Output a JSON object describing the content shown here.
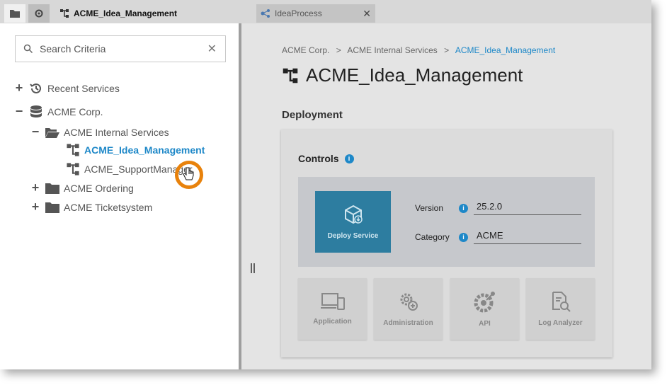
{
  "tabs": {
    "folder_icon": "folder-icon",
    "gear_icon": "gear-icon",
    "active_label": "ACME_Idea_Management",
    "second_label": "IdeaProcess",
    "close_glyph": "✕"
  },
  "sidebar": {
    "search_placeholder": "Search Criteria",
    "clear_glyph": "✕",
    "tree": {
      "recent": "Recent Services",
      "corp": "ACME Corp.",
      "internal": "ACME Internal Services",
      "idea": "ACME_Idea_Management",
      "support": "ACME_SupportManager",
      "ordering": "ACME Ordering",
      "ticket": "ACME Ticketsystem"
    },
    "plus": "+",
    "minus": "−"
  },
  "main": {
    "breadcrumb": [
      "ACME Corp.",
      "ACME Internal Services",
      "ACME_Idea_Management"
    ],
    "separator": ">",
    "title": "ACME_Idea_Management",
    "section": "Deployment",
    "controls_label": "Controls",
    "info_glyph": "i",
    "deploy_label": "Deploy Service",
    "version_label": "Version",
    "version_value": "25.2.0",
    "category_label": "Category",
    "category_value": "ACME",
    "tiles": [
      "Application",
      "Administration",
      "API",
      "Log Analyzer"
    ]
  },
  "colors": {
    "accent": "#1e88c8",
    "cursor_ring": "#e8820c",
    "deploy_bg": "#2d7da0"
  }
}
